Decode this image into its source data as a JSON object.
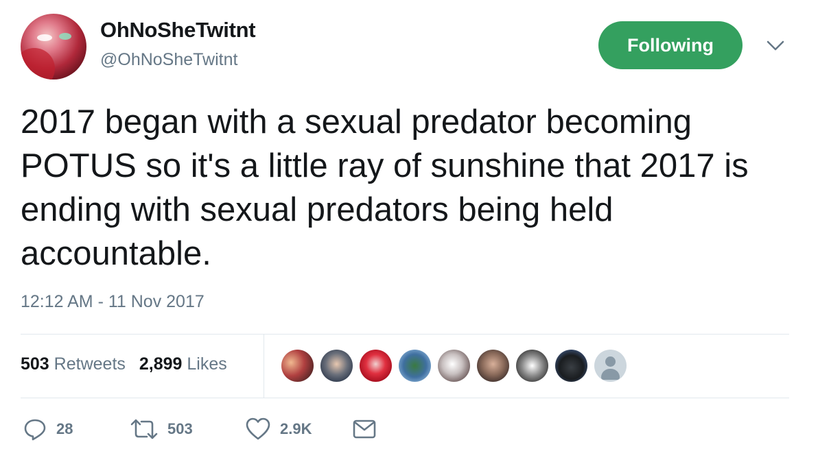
{
  "user": {
    "display_name": "OhNoSheTwitnt",
    "handle": "@OhNoSheTwitnt",
    "follow_label": "Following"
  },
  "tweet": {
    "text": "2017 began with a sexual predator becoming POTUS so it's a little ray of sunshine that 2017 is ending with sexual predators being held accountable.",
    "timestamp": "12:12 AM - 11 Nov 2017"
  },
  "stats": {
    "retweets_count": "503",
    "retweets_label": "Retweets",
    "likes_count": "2,899",
    "likes_label": "Likes"
  },
  "actions": {
    "replies": "28",
    "retweets": "503",
    "likes": "2.9K"
  },
  "colors": {
    "follow_button": "#34a05f",
    "text_primary": "#14171a",
    "text_secondary": "#657786",
    "divider": "#e1e8ed"
  },
  "icons": {
    "reply": "reply-icon",
    "retweet": "retweet-icon",
    "like": "heart-icon",
    "dm": "envelope-icon",
    "more": "chevron-down-icon"
  }
}
